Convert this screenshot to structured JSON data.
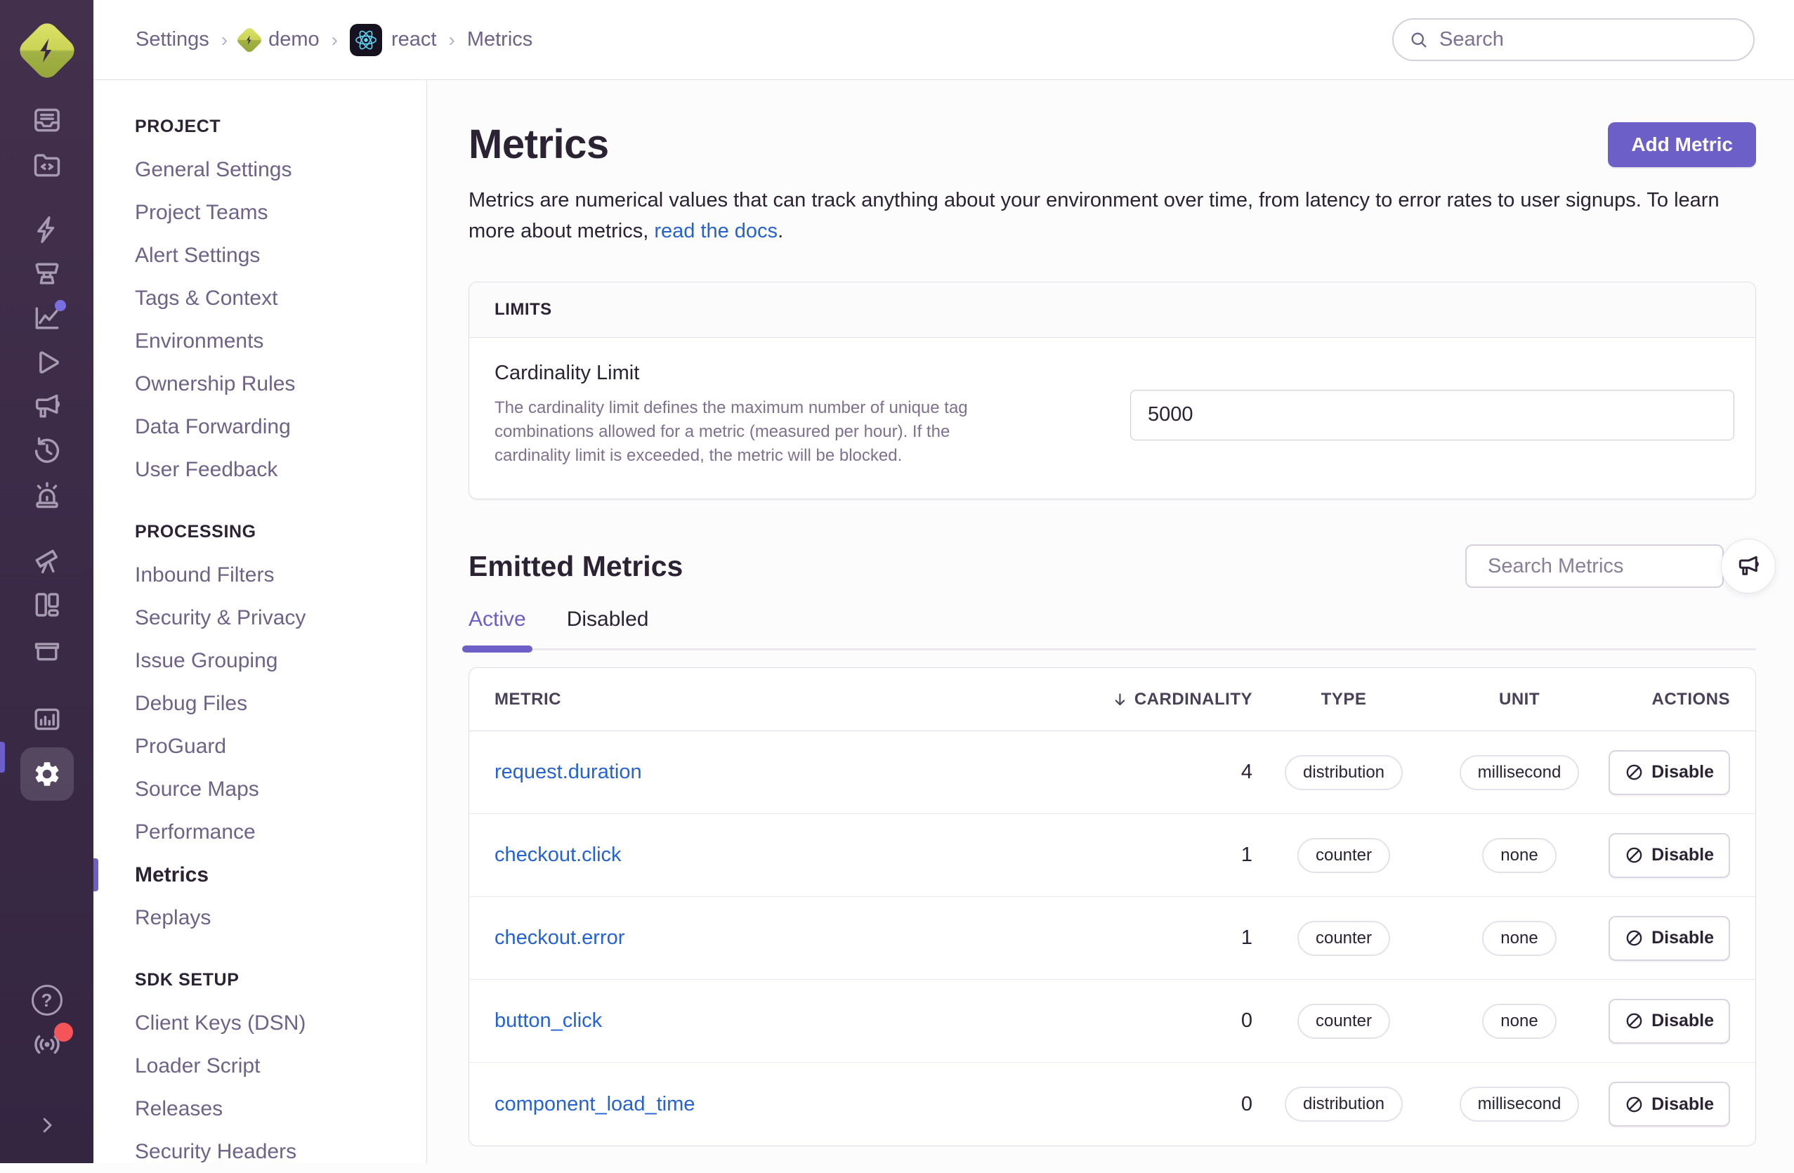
{
  "topbar": {
    "breadcrumbs": [
      {
        "label": "Settings"
      },
      {
        "label": "demo"
      },
      {
        "label": "react"
      },
      {
        "label": "Metrics"
      }
    ],
    "search_placeholder": "Search"
  },
  "nav": {
    "sections": [
      {
        "heading": "PROJECT",
        "items": [
          {
            "label": "General Settings"
          },
          {
            "label": "Project Teams"
          },
          {
            "label": "Alert Settings"
          },
          {
            "label": "Tags & Context"
          },
          {
            "label": "Environments"
          },
          {
            "label": "Ownership Rules"
          },
          {
            "label": "Data Forwarding"
          },
          {
            "label": "User Feedback"
          }
        ]
      },
      {
        "heading": "PROCESSING",
        "items": [
          {
            "label": "Inbound Filters"
          },
          {
            "label": "Security & Privacy"
          },
          {
            "label": "Issue Grouping"
          },
          {
            "label": "Debug Files"
          },
          {
            "label": "ProGuard"
          },
          {
            "label": "Source Maps"
          },
          {
            "label": "Performance"
          },
          {
            "label": "Metrics",
            "active": true
          },
          {
            "label": "Replays"
          }
        ]
      },
      {
        "heading": "SDK SETUP",
        "items": [
          {
            "label": "Client Keys (DSN)"
          },
          {
            "label": "Loader Script"
          },
          {
            "label": "Releases"
          },
          {
            "label": "Security Headers"
          }
        ]
      }
    ]
  },
  "main": {
    "title": "Metrics",
    "add_metric_button": "Add Metric",
    "description": {
      "text_before_link": "Metrics are numerical values that can track anything about your environment over time, from latency to error rates to user signups. To learn more about metrics, ",
      "link_text": "read the docs",
      "text_after_link": "."
    },
    "limits_panel": {
      "header": "LIMITS",
      "field_label": "Cardinality Limit",
      "field_help": "The cardinality limit defines the maximum number of unique tag combinations allowed for a metric (measured per hour). If the cardinality limit is exceeded, the metric will be blocked.",
      "input_value": "5000"
    },
    "emitted": {
      "heading": "Emitted Metrics",
      "search_placeholder": "Search Metrics",
      "tabs": [
        {
          "label": "Active",
          "active": true
        },
        {
          "label": "Disabled",
          "active": false
        }
      ]
    },
    "table": {
      "headers": {
        "metric": "METRIC",
        "cardinality": "CARDINALITY",
        "type": "TYPE",
        "unit": "UNIT",
        "actions": "ACTIONS"
      },
      "rows": [
        {
          "name": "request.duration",
          "cardinality": "4",
          "type": "distribution",
          "unit": "millisecond",
          "action": "Disable"
        },
        {
          "name": "checkout.click",
          "cardinality": "1",
          "type": "counter",
          "unit": "none",
          "action": "Disable"
        },
        {
          "name": "checkout.error",
          "cardinality": "1",
          "type": "counter",
          "unit": "none",
          "action": "Disable"
        },
        {
          "name": "button_click",
          "cardinality": "0",
          "type": "counter",
          "unit": "none",
          "action": "Disable"
        },
        {
          "name": "component_load_time",
          "cardinality": "0",
          "type": "distribution",
          "unit": "millisecond",
          "action": "Disable"
        }
      ]
    }
  },
  "icons": [
    "sentry-logo",
    "issues",
    "projects",
    "performance-lightning",
    "explore-projector",
    "insights-chart",
    "replays-play",
    "feedback-megaphone",
    "history-clock",
    "alerts-siren",
    "discover-telescope",
    "dashboards-layout",
    "crons-box",
    "stats-bars",
    "settings-gear",
    "help",
    "whats-new-broadcast",
    "collapse-chevron",
    "search",
    "arrow-down",
    "disable-slash",
    "react-logo"
  ],
  "colors": {
    "accent": "#6C5FC7",
    "link": "#2562D4",
    "sidebar_top": "#43304D",
    "sidebar_bottom": "#342541",
    "notification_red": "#F55459",
    "react_cyan": "#61DAFB",
    "logo_lime": "#CBD455"
  }
}
